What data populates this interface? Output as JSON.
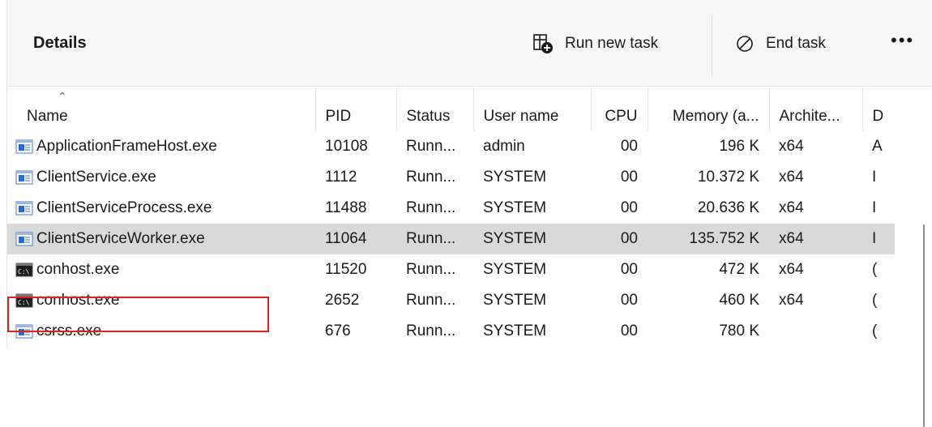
{
  "header": {
    "title": "Details",
    "run_new_task": "Run new task",
    "end_task": "End task",
    "more": "•••"
  },
  "table": {
    "columns": [
      "Name",
      "PID",
      "Status",
      "User name",
      "CPU",
      "Memory (a...",
      "Archite...",
      "D"
    ],
    "sorted_indicator": "^",
    "rows": [
      {
        "icon": "window-app-icon",
        "name": "ApplicationFrameHost.exe",
        "pid": "10108",
        "status": "Runn...",
        "user": "admin",
        "cpu": "00",
        "memory": "196 K",
        "arch": "x64",
        "desc": "A"
      },
      {
        "icon": "window-app-icon",
        "name": "ClientService.exe",
        "pid": "1112",
        "status": "Runn...",
        "user": "SYSTEM",
        "cpu": "00",
        "memory": "10.372 K",
        "arch": "x64",
        "desc": "I"
      },
      {
        "icon": "window-app-icon",
        "name": "ClientServiceProcess.exe",
        "pid": "11488",
        "status": "Runn...",
        "user": "SYSTEM",
        "cpu": "00",
        "memory": "20.636 K",
        "arch": "x64",
        "desc": "I"
      },
      {
        "icon": "window-app-icon",
        "name": "ClientServiceWorker.exe",
        "pid": "11064",
        "status": "Runn...",
        "user": "SYSTEM",
        "cpu": "00",
        "memory": "135.752 K",
        "arch": "x64",
        "desc": "I",
        "selected": true
      },
      {
        "icon": "console-icon",
        "name": "conhost.exe",
        "pid": "11520",
        "status": "Runn...",
        "user": "SYSTEM",
        "cpu": "00",
        "memory": "472 K",
        "arch": "x64",
        "desc": "("
      },
      {
        "icon": "console-icon",
        "name": "conhost.exe",
        "pid": "2652",
        "status": "Runn...",
        "user": "SYSTEM",
        "cpu": "00",
        "memory": "460 K",
        "arch": "x64",
        "desc": "("
      },
      {
        "icon": "window-app-icon",
        "name": "csrss.exe",
        "pid": "676",
        "status": "Runn...",
        "user": "SYSTEM",
        "cpu": "00",
        "memory": "780 K",
        "arch": "",
        "desc": "("
      }
    ]
  },
  "colors": {
    "selection": "#d9d9d9",
    "highlight_box": "#e02020",
    "app_icon_blue": "#1e6fd9"
  }
}
